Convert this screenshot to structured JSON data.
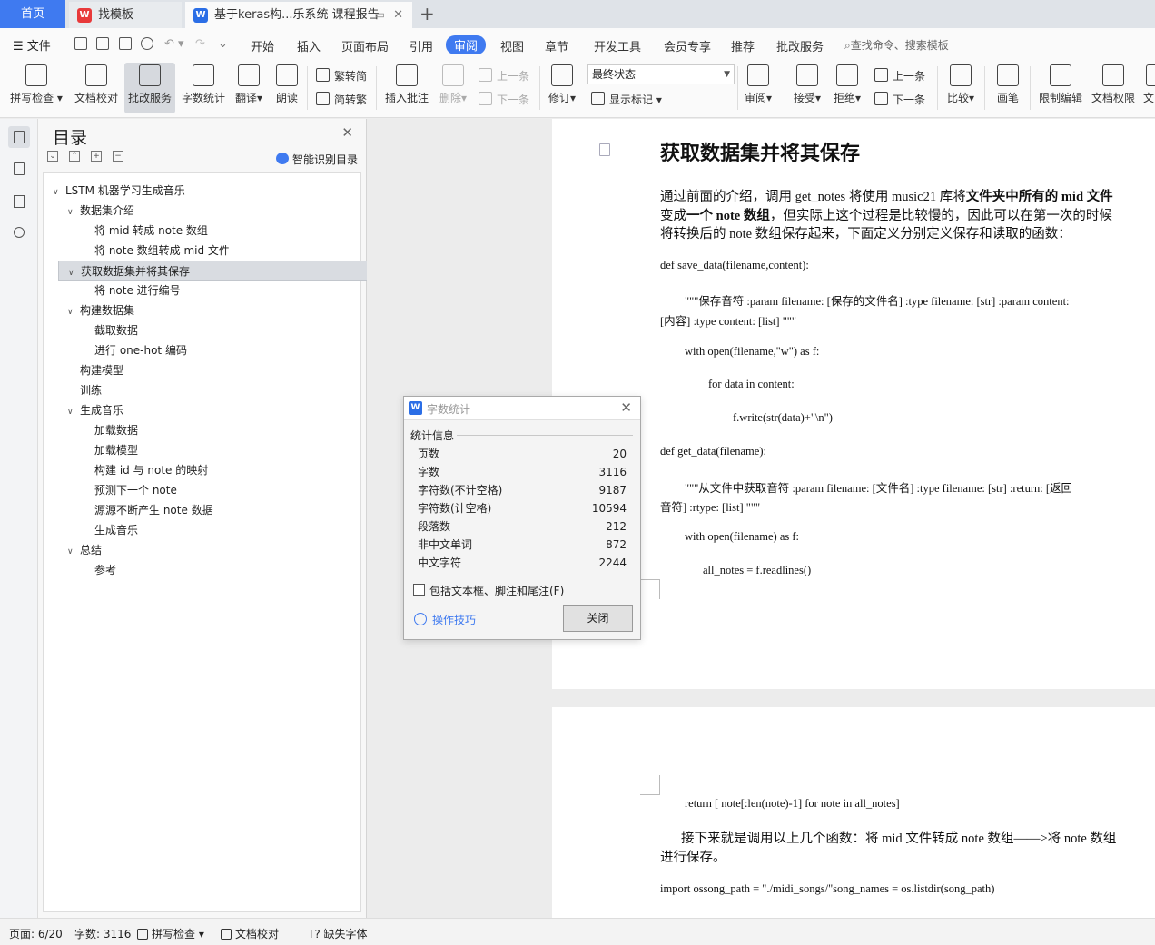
{
  "tabs": {
    "home": "首页",
    "tab1": "找模板",
    "tab2": "基于keras构...乐系统 课程报告",
    "tab1_icon": "wps-red-icon",
    "tab2_icon": "wps-writer-icon"
  },
  "menu": {
    "file": "文件",
    "items": [
      "开始",
      "插入",
      "页面布局",
      "引用",
      "审阅",
      "视图",
      "章节",
      "开发工具",
      "会员专享",
      "推荐",
      "批改服务"
    ],
    "active": "审阅",
    "search": "查找命令、搜索模板"
  },
  "toolbar": {
    "spell_check": "拼写检查",
    "doc_proof": "文档校对",
    "correct_service": "批改服务",
    "word_count": "字数统计",
    "translate": "翻译",
    "read_aloud": "朗读",
    "trad_to_simp": "繁转简",
    "simp_to_trad": "简转繁",
    "insert_comment": "插入批注",
    "delete": "删除",
    "prev_item": "上一条",
    "next_item": "下一条",
    "revise": "修订",
    "final_status": "最终状态",
    "show_markup": "显示标记",
    "review": "审阅",
    "accept": "接受",
    "reject": "拒绝",
    "prev_item2": "上一条",
    "next_item2": "下一条",
    "compare": "比较",
    "pen": "画笔",
    "restrict_edit": "限制编辑",
    "doc_permission": "文档权限",
    "cut_text": "文"
  },
  "toc": {
    "title": "目录",
    "smart": "智能识别目录",
    "items": [
      {
        "label": "LSTM 机器学习生成音乐",
        "level": 0,
        "expandable": true
      },
      {
        "label": "数据集介绍",
        "level": 1,
        "expandable": true
      },
      {
        "label": "将 mid 转成 note 数组",
        "level": 2,
        "expandable": false
      },
      {
        "label": "将 note 数组转成 mid 文件",
        "level": 2,
        "expandable": false
      },
      {
        "label": "获取数据集并将其保存",
        "level": 1,
        "expandable": true,
        "selected": true
      },
      {
        "label": "将 note 进行编号",
        "level": 2,
        "expandable": false
      },
      {
        "label": "构建数据集",
        "level": 1,
        "expandable": true
      },
      {
        "label": "截取数据",
        "level": 2,
        "expandable": false
      },
      {
        "label": "进行 one-hot 编码",
        "level": 2,
        "expandable": false
      },
      {
        "label": "构建模型",
        "level": 1,
        "expandable": false
      },
      {
        "label": "训练",
        "level": 1,
        "expandable": false
      },
      {
        "label": "生成音乐",
        "level": 1,
        "expandable": true
      },
      {
        "label": "加载数据",
        "level": 2,
        "expandable": false
      },
      {
        "label": "加载模型",
        "level": 2,
        "expandable": false
      },
      {
        "label": "构建 id 与 note 的映射",
        "level": 2,
        "expandable": false
      },
      {
        "label": "预测下一个 note",
        "level": 2,
        "expandable": false
      },
      {
        "label": "源源不断产生 note 数据",
        "level": 2,
        "expandable": false
      },
      {
        "label": "生成音乐",
        "level": 2,
        "expandable": false
      },
      {
        "label": "总结",
        "level": 1,
        "expandable": true
      },
      {
        "label": "参考",
        "level": 2,
        "expandable": false
      }
    ]
  },
  "doc": {
    "heading": "获取数据集并将其保存",
    "p1a": "通过前面的介绍，调用 get_notes 将使用 music21 库将",
    "p1b": "文件夹中所有的 mid 文件",
    "p2a": "变成",
    "p2b": "一个 note 数组",
    "p2c": "，但实际上这个过程是比较慢的，因此可以在第一次的时候",
    "p3": "将转换后的 note 数组保存起来，下面定义分别定义保存和读取的函数：",
    "c1": "def save_data(filename,content):",
    "c2": "\"\"\"保存音符        :param filename: [保存的文件名]        :type filename: [str]        :param content:",
    "c3": "[内容]        :type content: [list]        \"\"\"",
    "c4": "with open(filename,\"w\") as f:",
    "c5": "for data in content:",
    "c6": "f.write(str(data)+\"\\n\")",
    "c7": "def get_data(filename):",
    "c8": "\"\"\"从文件中获取音符        :param filename: [文件名]        :type filename: [str]        :return: [返回",
    "c9": "音符]        :rtype: [list]        \"\"\"",
    "c10": "with open(filename) as f:",
    "c11": "all_notes = f.readlines()",
    "c12": "return [ note[:len(note)-1]    for note in all_notes]",
    "p4": "接下来就是调用以上几个函数：将 mid 文件转成 note 数组——>将 note 数组",
    "p5": "进行保存。",
    "c13": "import ossong_path = \"./midi_songs/\"song_names = os.listdir(song_path)"
  },
  "dialog": {
    "title": "字数统计",
    "section": "统计信息",
    "stats": [
      {
        "label": "页数",
        "value": "20"
      },
      {
        "label": "字数",
        "value": "3116"
      },
      {
        "label": "字符数(不计空格)",
        "value": "9187"
      },
      {
        "label": "字符数(计空格)",
        "value": "10594"
      },
      {
        "label": "段落数",
        "value": "212"
      },
      {
        "label": "非中文单词",
        "value": "872"
      },
      {
        "label": "中文字符",
        "value": "2244"
      }
    ],
    "include_label": "包括文本框、脚注和尾注(F)",
    "include_checked": false,
    "tips": "操作技巧",
    "close": "关闭"
  },
  "status": {
    "page": "页面: 6/20",
    "words": "字数: 3116",
    "spell": "拼写检查",
    "proof": "文档校对",
    "missing_font": "缺失字体"
  },
  "colors": {
    "accent": "#3f7af0",
    "wps_red": "#e8393a"
  }
}
